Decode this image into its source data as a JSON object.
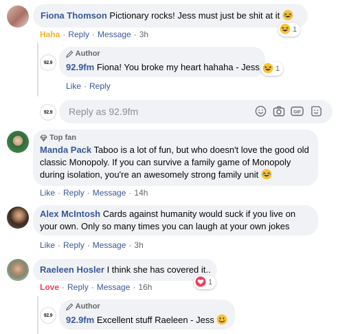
{
  "comments": [
    {
      "author": "Fiona Thomson",
      "text": "Pictionary rocks! Jess must just be shit at it",
      "reaction_label": "Haha",
      "actions": [
        "Reply",
        "Message"
      ],
      "time": "3h",
      "reaction_count": "1",
      "reply": {
        "badge": "Author",
        "author": "92.9fm",
        "text": "Fiona! You broke my heart hahaha - Jess",
        "reaction_count": "1",
        "actions": [
          "Like",
          "Reply"
        ]
      }
    },
    {
      "badge": "Top fan",
      "author": "Manda Pack",
      "text": "Taboo is a lot of fun, but who doesn't love the good old classic Monopoly. If you can survive a family game of Monopoly during isolation, you're an awesomely strong family unit",
      "actions": [
        "Like",
        "Reply",
        "Message"
      ],
      "time": "14h"
    },
    {
      "author": "Alex McIntosh",
      "text": "Cards against humanity would suck if you live on your own. Only so many times you can laugh at your own jokes",
      "actions": [
        "Like",
        "Reply",
        "Message"
      ],
      "time": "3h"
    },
    {
      "author": "Raeleen Hosler",
      "text": "I think she has covered it..",
      "reaction_label": "Love",
      "actions": [
        "Reply",
        "Message"
      ],
      "time": "16h",
      "reaction_count": "1",
      "reply": {
        "badge": "Author",
        "author": "92.9fm",
        "text": "Excellent stuff Raeleen - Jess"
      }
    }
  ],
  "reply_box": {
    "placeholder": "Reply as 92.9fm"
  },
  "page_logo": "92.9",
  "colors": {
    "name": "#385898",
    "haha": "#f7b125",
    "love": "#f33e58",
    "bubble": "#f0f2f5",
    "meta": "#65676b"
  },
  "icons": [
    "laughing-emoji-icon",
    "pencil-icon",
    "diamond-icon",
    "smiley-icon",
    "camera-icon",
    "gif-icon",
    "sticker-icon",
    "heart-icon",
    "smile-emoji-icon"
  ]
}
